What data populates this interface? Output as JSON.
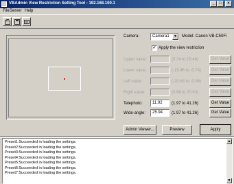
{
  "window": {
    "title": "VBAdmin View Restriction Setting Tool - 192.168.100.1",
    "minimize": "_",
    "maximize": "□",
    "close": "×"
  },
  "menu": [
    "File",
    "Server",
    "Help"
  ],
  "toolbar": {
    "icons": [
      "open-settings-icon",
      "save-settings-icon",
      "export-icon"
    ]
  },
  "camera": {
    "label": "Camera:",
    "selected": "Camera1",
    "model_label": "Model:",
    "model": "Canon VB-C50Fi"
  },
  "restriction": {
    "checkbox_label": "Apply the view restriction",
    "checked": true
  },
  "rows": [
    {
      "label": "Upper value:",
      "value": "",
      "range": "(0.74 to 15.46)",
      "button": "Get Value",
      "enabled": false
    },
    {
      "label": "Lower value:",
      "value": "",
      "range": "(-15.46 to -0.74)",
      "button": "Get Value",
      "enabled": false
    },
    {
      "label": "Left value:",
      "value": "",
      "range": "(-20.63 to -0.98)",
      "button": "Get Value",
      "enabled": false
    },
    {
      "label": "Right value:",
      "value": "",
      "range": "(0.98 to 20.63)",
      "button": "Get Value",
      "enabled": false
    },
    {
      "label": "Telephoto:",
      "value": "11.92",
      "range": "(1.97 to 41.26)",
      "button": "Get Value",
      "enabled": true
    },
    {
      "label": "Wide-angle:",
      "value": "25.94",
      "range": "(1.97 to 41.26)",
      "button": "Get Value",
      "enabled": true
    }
  ],
  "actions": {
    "admin_viewer": "Admin Viewer...",
    "preview": "Preview",
    "apply": "Apply"
  },
  "log": [
    "Preset1:Succeeded in loading the settings.",
    "Preset2:Succeeded in loading the settings.",
    "Preset3:Succeeded in loading the settings.",
    "Preset4:Succeeded in loading the settings.",
    "Preset5:Succeeded in loading the settings.",
    "Preset6:Succeeded in loading the settings.",
    "Preset7:Succeeded in loading the settings."
  ]
}
